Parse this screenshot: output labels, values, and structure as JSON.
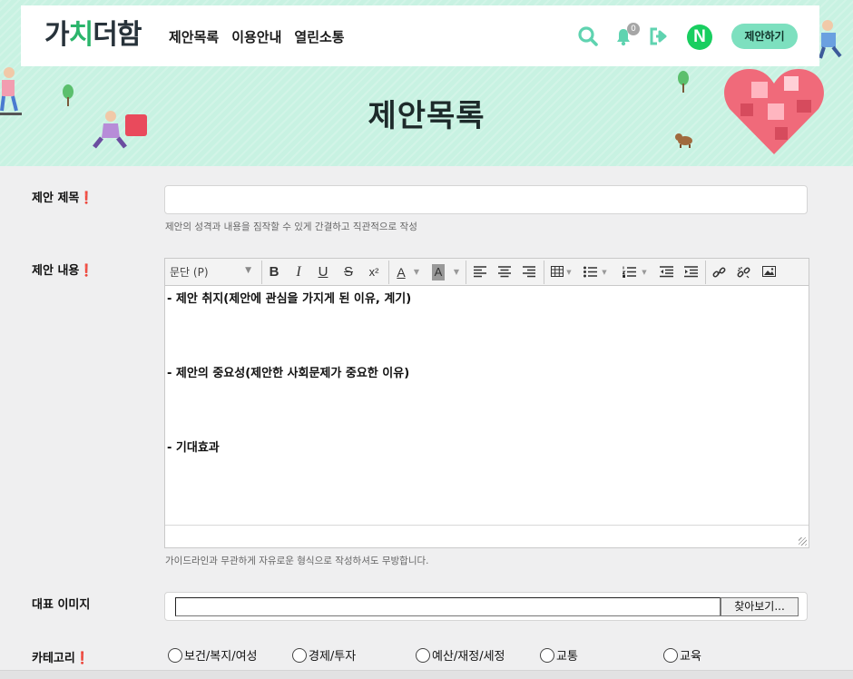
{
  "header": {
    "logo_pre": "가",
    "logo_accent": "치",
    "logo_post": "더함",
    "menu": [
      "제안목록",
      "이용안내",
      "열린소통"
    ],
    "notification_count": "0",
    "naver_letter": "N",
    "propose_button": "제안하기",
    "icons": [
      "search-icon",
      "bell-icon",
      "logout-icon",
      "naver-login-icon"
    ],
    "accent_color": "#2bb56b",
    "mint_color": "#7de0bf"
  },
  "hero": {
    "title": "제안목록",
    "background_color": "#c8f2e2"
  },
  "form": {
    "title_field": {
      "label": "제안 제목",
      "required_mark": "❗",
      "value": "",
      "hint": "제안의 성격과 내용을 짐작할 수 있게 간결하고 직관적으로 작성"
    },
    "content_field": {
      "label": "제안 내용",
      "required_mark": "❗",
      "toolbar": {
        "format_select": "문단 (P)",
        "buttons": [
          "bold",
          "italic",
          "underline",
          "strikethrough",
          "superscript",
          "font-color",
          "background-color",
          "align-left",
          "align-center",
          "align-right",
          "table",
          "bullet-list",
          "numbered-list",
          "outdent",
          "indent",
          "link",
          "unlink",
          "image"
        ],
        "bold": "B",
        "italic": "I",
        "underline": "U",
        "strike": "S",
        "superscript": "x²",
        "font_color": "A",
        "bg_color": "A"
      },
      "lines": [
        "- 제안 취지(제안에 관심을 가지게 된 이유, 계기)",
        "- 제안의 중요성(제안한 사회문제가 중요한 이유)",
        "- 기대효과"
      ],
      "hint": "가이드라인과 무관하게 자유로운 형식으로 작성하셔도 무방합니다."
    },
    "image_field": {
      "label": "대표 이미지",
      "value": "",
      "browse_button": "찾아보기..."
    },
    "category_field": {
      "label": "카테고리",
      "required_mark": "❗",
      "options": [
        "보건/복지/여성",
        "경제/투자",
        "예산/재정/세정",
        "교통",
        "교육"
      ]
    }
  }
}
